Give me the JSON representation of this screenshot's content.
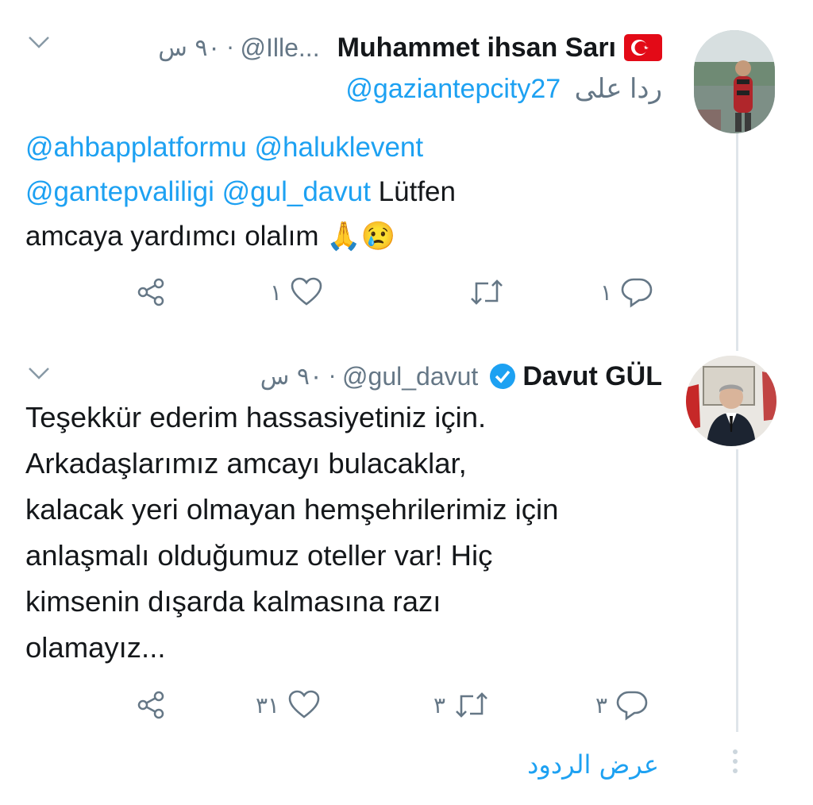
{
  "tweets": [
    {
      "name": "Muhammet ihsan Sarı",
      "flag": "🇹🇷",
      "handle": "@Ille...",
      "separator": "·",
      "time": "٩٠ س",
      "reply_label": "ردا على",
      "reply_to": "@gaziantepcity27",
      "text_lines": [
        [
          "@ahbapplatformu",
          " ",
          "@haluklevent"
        ],
        [
          "@gantepvaliligi",
          " ",
          "@gul_davut",
          " Lütfen"
        ],
        [
          "amcaya yardımcı olalım "
        ]
      ],
      "emoji": "🙏😢",
      "actions": {
        "reply_count": "١",
        "retweet_count": "",
        "like_count": "١"
      }
    },
    {
      "name": "Davut GÜL",
      "verified": true,
      "handle": "@gul_davut",
      "separator": "·",
      "time": "٩٠ س",
      "text": [
        "Teşekkür ederim hassasiyetiniz için.",
        "Arkadaşlarımız amcayı bulacaklar,",
        "kalacak yeri olmayan hemşehrilerimiz için",
        "anlaşmalı olduğumuz oteller var! Hiç",
        "kimsenin dışarda kalmasına razı",
        "olamayız..."
      ],
      "actions": {
        "reply_count": "٣",
        "retweet_count": "٣",
        "like_count": "٣١"
      }
    }
  ],
  "show_replies": "عرض الردود",
  "colors": {
    "accent": "#1da1f2",
    "muted": "#657786",
    "text": "#14171a"
  },
  "icons": [
    "chevron-down-icon",
    "share-icon",
    "like-icon",
    "retweet-icon",
    "reply-icon",
    "verified-icon"
  ]
}
